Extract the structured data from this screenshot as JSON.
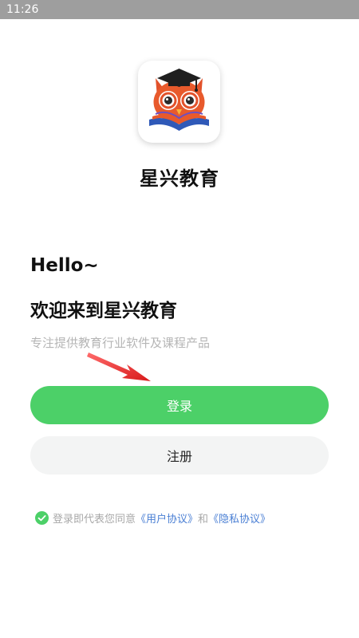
{
  "status_bar": {
    "time": "11:26"
  },
  "app": {
    "name": "星兴教育",
    "logo_icon": "owl-graduation-cap-book-icon"
  },
  "intro": {
    "hello": "Hello~",
    "welcome": "欢迎来到星兴教育",
    "tagline": "专注提供教育行业软件及课程产品"
  },
  "buttons": {
    "login_label": "登录",
    "register_label": "注册"
  },
  "agreement": {
    "checked": true,
    "prefix": "登录即代表您同意",
    "user_agreement": "《用户协议》",
    "conjunction": "和",
    "privacy_policy": "《隐私协议》"
  },
  "colors": {
    "accent_green": "#4cd068",
    "link_blue": "#4a7fd4",
    "hint_arrow_red": "#e52323"
  }
}
